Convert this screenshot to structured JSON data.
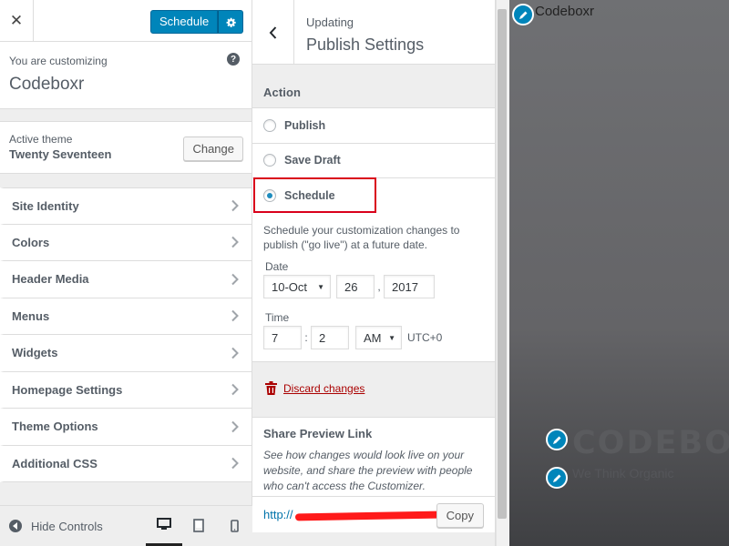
{
  "header": {
    "close_glyph": "✕",
    "schedule_label": "Schedule"
  },
  "customizing": {
    "label": "You are customizing",
    "site_name": "Codeboxr",
    "help_glyph": "?"
  },
  "theme": {
    "label": "Active theme",
    "name": "Twenty Seventeen",
    "change_label": "Change"
  },
  "sections": [
    {
      "label": "Site Identity"
    },
    {
      "label": "Colors"
    },
    {
      "label": "Header Media"
    },
    {
      "label": "Menus"
    },
    {
      "label": "Widgets"
    },
    {
      "label": "Homepage Settings"
    },
    {
      "label": "Theme Options"
    },
    {
      "label": "Additional CSS"
    }
  ],
  "footer": {
    "hide_controls": "Hide Controls"
  },
  "publish_settings": {
    "updating": "Updating",
    "title": "Publish Settings",
    "action_label": "Action",
    "options": [
      {
        "label": "Publish",
        "checked": false
      },
      {
        "label": "Save Draft",
        "checked": false
      },
      {
        "label": "Schedule",
        "checked": true
      }
    ],
    "schedule_desc": "Schedule your customization changes to publish (\"go live\") at a future date.",
    "date_label": "Date",
    "month": "10-Oct",
    "day": "26",
    "year": "2017",
    "date_sep": ",",
    "time_label": "Time",
    "hour": "7",
    "time_sep": ":",
    "minute": "2",
    "ampm": "AM",
    "timezone": "UTC+0",
    "discard": "Discard changes",
    "share_title": "Share Preview Link",
    "share_desc": "See how changes would look live on your website, and share the preview with people who can't access the Customizer.",
    "url_prefix": "http://",
    "copy_label": "Copy"
  },
  "preview": {
    "site_title": "Codeboxr",
    "brand": "CODEBOXR",
    "tagline": "We Think Organic"
  },
  "colors": {
    "primary": "#0085ba",
    "highlight": "#d9001b",
    "discard": "#a00000"
  }
}
